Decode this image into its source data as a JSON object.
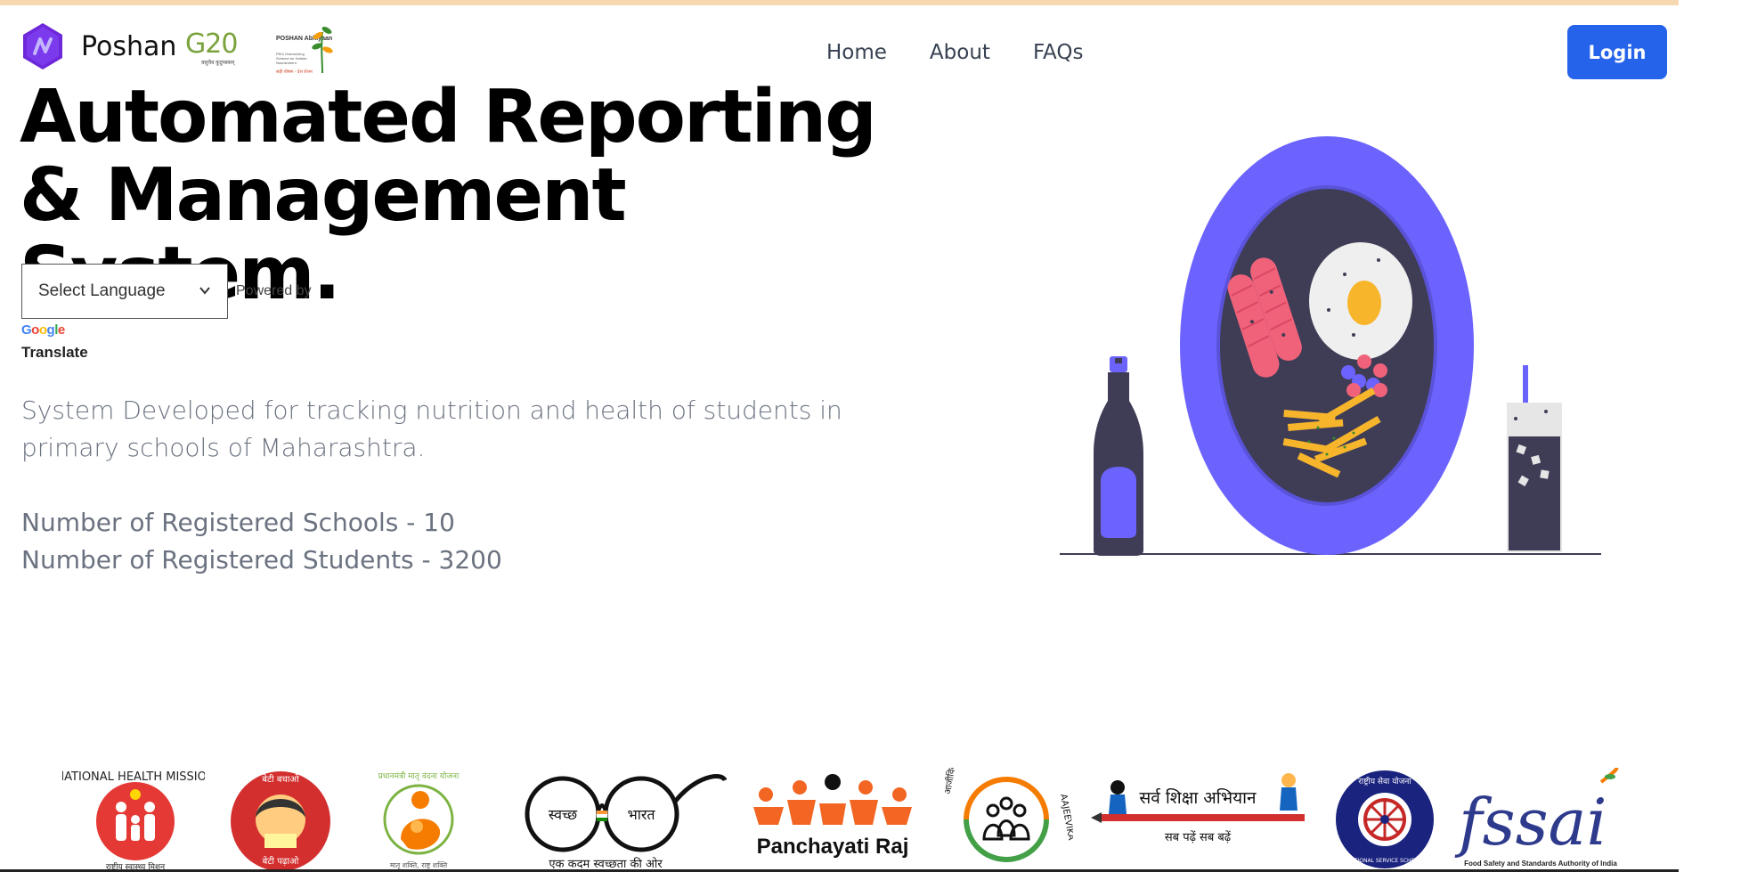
{
  "header": {
    "brand_name": "Poshan",
    "g20_text": "G20",
    "g20_sub": "वसुधैव कुटुम्बकम्",
    "poshan_logo_title": "POSHAN Abhiyaan",
    "poshan_logo_sub": "PM's Overarching Scheme for Holistic Nourishment",
    "poshan_logo_tag": "सही पोषण - देश रोशन",
    "nav": [
      "Home",
      "About",
      "FAQs"
    ],
    "login_label": "Login"
  },
  "hero": {
    "headline_line1": "Automated Reporting",
    "headline_line2": "& Management System.",
    "language_select": "Select Language",
    "powered_by": "Powered by",
    "google": "Google",
    "translate": "Translate",
    "description": "System Developed for tracking nutrition and health of students in primary schools of Maharashtra.",
    "registered_schools": "Number of Registered Schools - 10",
    "registered_students": "Number of Registered Students - 3200"
  },
  "partners": {
    "nhm_text": "NATIONAL HEALTH MISSION",
    "nhm_hindi": "राष्ट्रीय स्वास्थ्य मिशन",
    "bbbp_top": "बेटी बचाओ",
    "bbbp_bottom": "बेटी पढ़ाओ",
    "pmmvy_text": "प्रधानमंत्री मातृ वंदना योजना",
    "pmmvy_sub": "मातृ शक्ति, राष्ट्र शक्ति",
    "swachh_left": "स्वच्छ",
    "swachh_right": "भारत",
    "swachh_tag": "एक कदम स्वच्छता की ओर",
    "panchayati": "Panchayati Raj",
    "aajeevika_left": "आजीविका",
    "aajeevika_right": "AAJEEVIKA",
    "ssa_title": "सर्व शिक्षा अभियान",
    "ssa_tag": "सब पढ़ें सब बढ़ें",
    "nss_top": "राष्ट्रीय सेवा योजना",
    "nss_bottom": "NATIONAL SERVICE SCHEME",
    "fssai": "fssai",
    "fssai_sub": "Food Safety and Standards Authority of India"
  },
  "colors": {
    "login_bg": "#2563eb",
    "plate": "#6c63ff",
    "plate_inner": "#3f3d56",
    "top_strip": "#f6d7b0"
  }
}
